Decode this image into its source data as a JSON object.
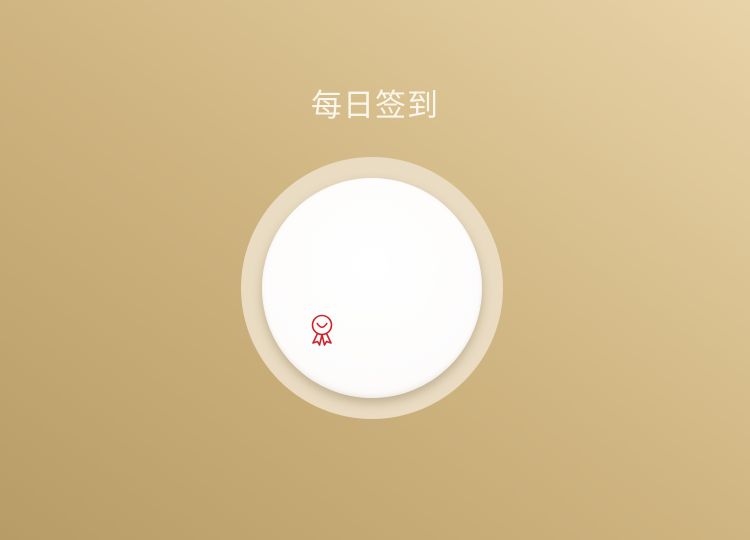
{
  "header": {
    "title": "每日签到"
  },
  "checkin": {
    "icon": "award-ribbon-icon",
    "accent_color": "#d0202a"
  }
}
